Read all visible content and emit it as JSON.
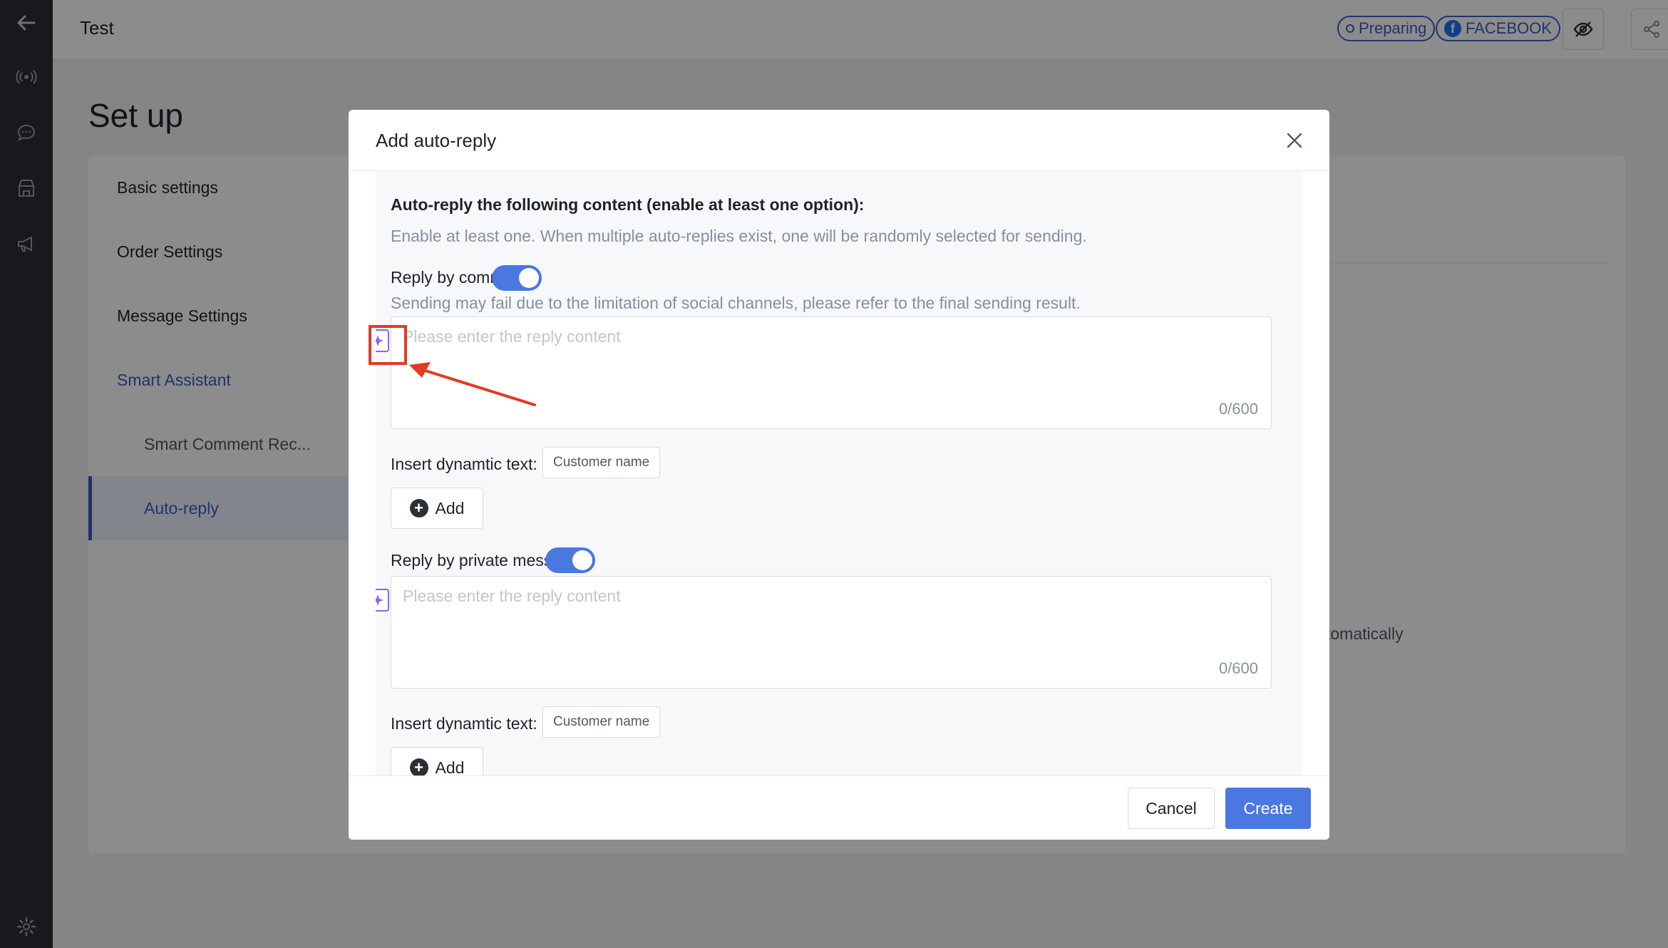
{
  "header": {
    "title": "Test",
    "status_badge": "Preparing",
    "channel_badge": "FACEBOOK"
  },
  "page": {
    "title": "Set up",
    "sidebar_items": [
      {
        "label": "Basic settings"
      },
      {
        "label": "Order Settings"
      },
      {
        "label": "Message Settings"
      },
      {
        "label": "Smart Assistant"
      },
      {
        "label": "Smart Comment Rec..."
      },
      {
        "label": "Auto-reply"
      }
    ],
    "background_text": "tomatically"
  },
  "modal": {
    "title": "Add auto-reply",
    "heading": "Auto-reply the following content (enable at least one option):",
    "hint": "Enable at least one. When multiple auto-replies exist, one will be randomly selected for sending.",
    "comment": {
      "label": "Reply by comment",
      "enabled": true,
      "warning": "Sending may fail due to the limitation of social channels, please refer to the final sending result.",
      "placeholder": "Please enter the reply content",
      "value": "",
      "count": "0/600",
      "insert_label": "Insert dynamtic text:",
      "chip": "Customer name",
      "add_label": "Add"
    },
    "private": {
      "label": "Reply by private message",
      "enabled": true,
      "placeholder": "Please enter the reply content",
      "value": "",
      "count": "0/600",
      "insert_label": "Insert dynamtic text:",
      "chip": "Customer name",
      "add_label": "Add"
    },
    "cancel_label": "Cancel",
    "create_label": "Create"
  },
  "colors": {
    "accent": "#4a78e0",
    "rail": "#2b2f36",
    "annotation": "#e03b24",
    "ai_icon": "#8e63e6"
  },
  "icons": [
    "back-arrow-icon",
    "broadcast-icon",
    "chat-icon",
    "store-icon",
    "megaphone-icon",
    "gear-icon",
    "eye-off-icon",
    "share-icon",
    "close-icon",
    "ai-sparkle-icon",
    "plus-circle-icon"
  ]
}
